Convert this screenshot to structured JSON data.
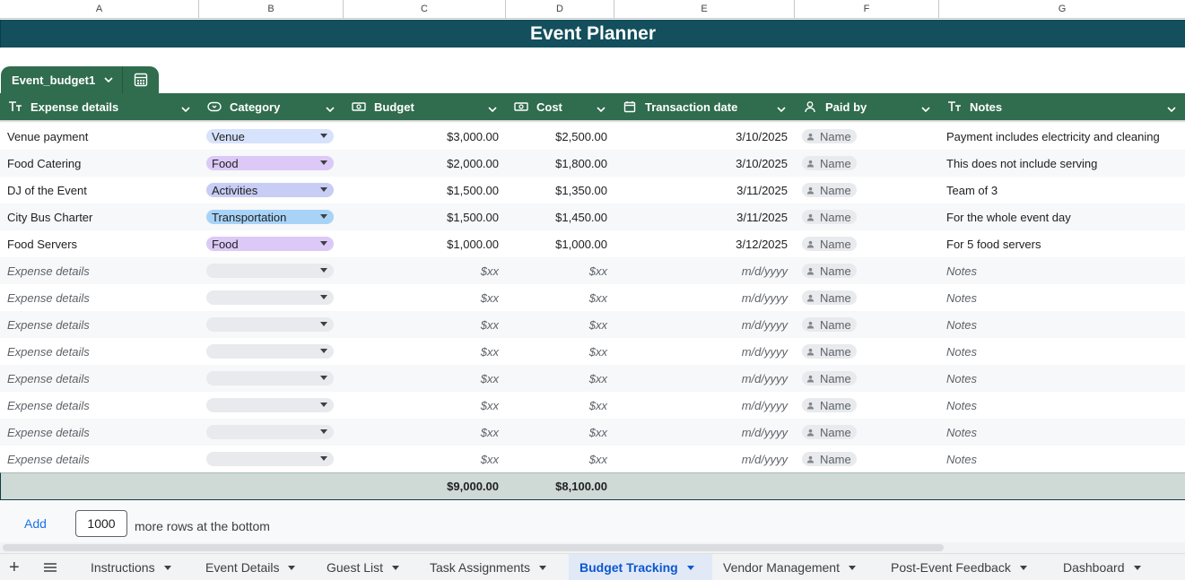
{
  "columns": {
    "letters": [
      "A",
      "B",
      "C",
      "D",
      "E",
      "F",
      "G"
    ]
  },
  "title": "Event Planner",
  "table": {
    "name": "Event_budget1",
    "headers": {
      "expense_details": "Expense details",
      "category": "Category",
      "budget": "Budget",
      "cost": "Cost",
      "transaction_date": "Transaction date",
      "paid_by": "Paid by",
      "notes": "Notes"
    },
    "rows": [
      {
        "expense": "Venue payment",
        "category": "Venue",
        "category_color": "#d7e3fc",
        "budget": "$3,000.00",
        "cost": "$2,500.00",
        "date": "3/10/2025",
        "paid_by": "Name",
        "notes": "Payment includes electricity and cleaning"
      },
      {
        "expense": "Food Catering",
        "category": "Food",
        "category_color": "#dcc9f7",
        "budget": "$2,000.00",
        "cost": "$1,800.00",
        "date": "3/10/2025",
        "paid_by": "Name",
        "notes": "This does not include serving"
      },
      {
        "expense": "DJ of the Event",
        "category": "Activities",
        "category_color": "#c8cdf5",
        "budget": "$1,500.00",
        "cost": "$1,350.00",
        "date": "3/11/2025",
        "paid_by": "Name",
        "notes": "Team of 3"
      },
      {
        "expense": "City Bus Charter",
        "category": "Transportation",
        "category_color": "#a8d3f7",
        "budget": "$1,500.00",
        "cost": "$1,450.00",
        "date": "3/11/2025",
        "paid_by": "Name",
        "notes": "For the whole event day"
      },
      {
        "expense": "Food Servers",
        "category": "Food",
        "category_color": "#dcc9f7",
        "budget": "$1,000.00",
        "cost": "$1,000.00",
        "date": "3/12/2025",
        "paid_by": "Name",
        "notes": "For 5 food servers"
      }
    ],
    "placeholder_row": {
      "expense": "Expense details",
      "budget": "$xx",
      "cost": "$xx",
      "date": "m/d/yyyy",
      "paid_by": "Name",
      "notes": "Notes",
      "category_color": "#e8eaed"
    },
    "placeholder_count": 8,
    "totals": {
      "budget": "$9,000.00",
      "cost": "$8,100.00"
    }
  },
  "add_rows": {
    "button": "Add",
    "count": "1000",
    "suffix": "more rows at the bottom"
  },
  "sheets": [
    {
      "label": "Instructions",
      "active": false
    },
    {
      "label": "Event Details",
      "active": false
    },
    {
      "label": "Guest List",
      "active": false
    },
    {
      "label": "Task Assignments",
      "active": false
    },
    {
      "label": "Budget Tracking",
      "active": true
    },
    {
      "label": "Vendor Management",
      "active": false
    },
    {
      "label": "Post-Event Feedback",
      "active": false
    },
    {
      "label": "Dashboard",
      "active": false
    }
  ],
  "colors": {
    "title_band": "#134f5c",
    "table_header": "#306c4e",
    "footer": "#cfd9d5",
    "active_tab": "#0b57d0"
  },
  "icons": {
    "table_view": "calculator-grid-icon",
    "add_sheet": "plus-icon",
    "all_sheets": "menu-icon"
  }
}
